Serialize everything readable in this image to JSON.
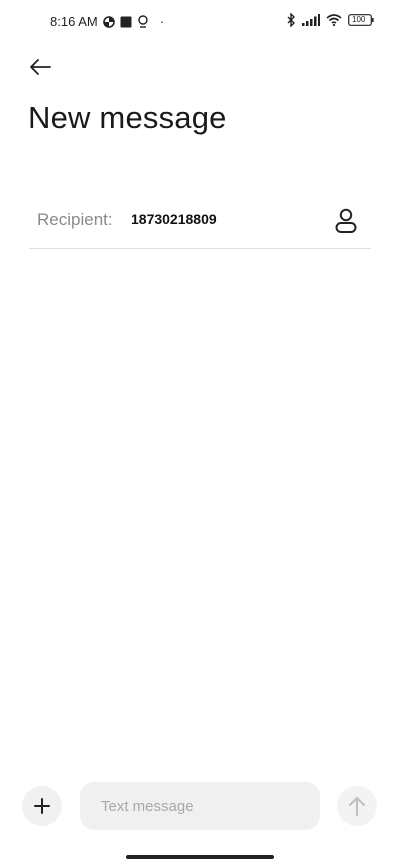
{
  "status_bar": {
    "time": "8:16 AM",
    "dot": "·",
    "battery": "100",
    "icons": [
      "data-saver-icon",
      "square-notification-icon",
      "location-icon",
      "bluetooth-icon",
      "signal-icon",
      "wifi-icon",
      "battery-icon"
    ]
  },
  "header": {
    "back_icon": "back-arrow-icon",
    "title": "New message"
  },
  "recipient": {
    "label": "Recipient:",
    "value": "18730218809",
    "contact_icon": "contact-person-icon"
  },
  "compose": {
    "add_icon": "plus-icon",
    "placeholder": "Text message",
    "value": "",
    "send_icon": "arrow-up-icon"
  }
}
